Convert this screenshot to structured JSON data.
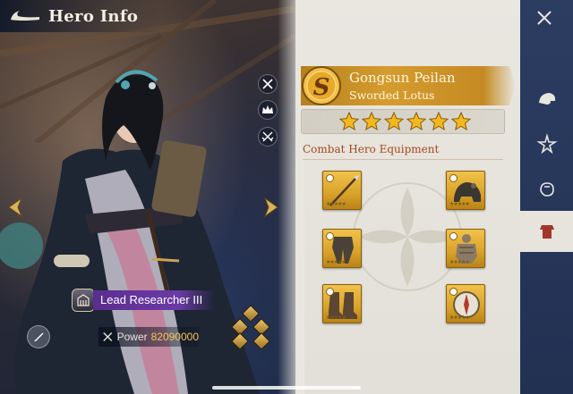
{
  "header": {
    "title": "Hero Info",
    "back_icon": "back-arrow-icon"
  },
  "hero": {
    "grade": "S",
    "name": "Gongsun Peilan",
    "title": "Sworded Lotus",
    "stars": 6,
    "rank_label": "Lead Researcher III",
    "power_label": "Power",
    "power_value": "82090000"
  },
  "equipment": {
    "section_title": "Combat Hero Equipment",
    "slots": [
      {
        "icon": "spear-icon"
      },
      {
        "icon": "mount-armor-icon"
      },
      {
        "icon": "leg-armor-icon"
      },
      {
        "icon": "body-armor-icon"
      },
      {
        "icon": "boots-icon"
      },
      {
        "icon": "compass-icon"
      }
    ]
  },
  "side_tools": [
    "crossed-swords-icon",
    "crown-icon",
    "crossed-blades-icon"
  ],
  "rail": {
    "items": [
      {
        "icon": "close-icon"
      },
      {
        "icon": "helmet-icon"
      },
      {
        "icon": "star-skill-icon"
      },
      {
        "icon": "fist-icon"
      },
      {
        "icon": "armor-icon",
        "active": true
      }
    ]
  },
  "colors": {
    "accent_gold": "#d59c2e",
    "rank_purple": "#6b3aa6",
    "power_gold": "#f0c65a",
    "section_title": "#a8471e",
    "rail_blue": "#2c3d62"
  }
}
